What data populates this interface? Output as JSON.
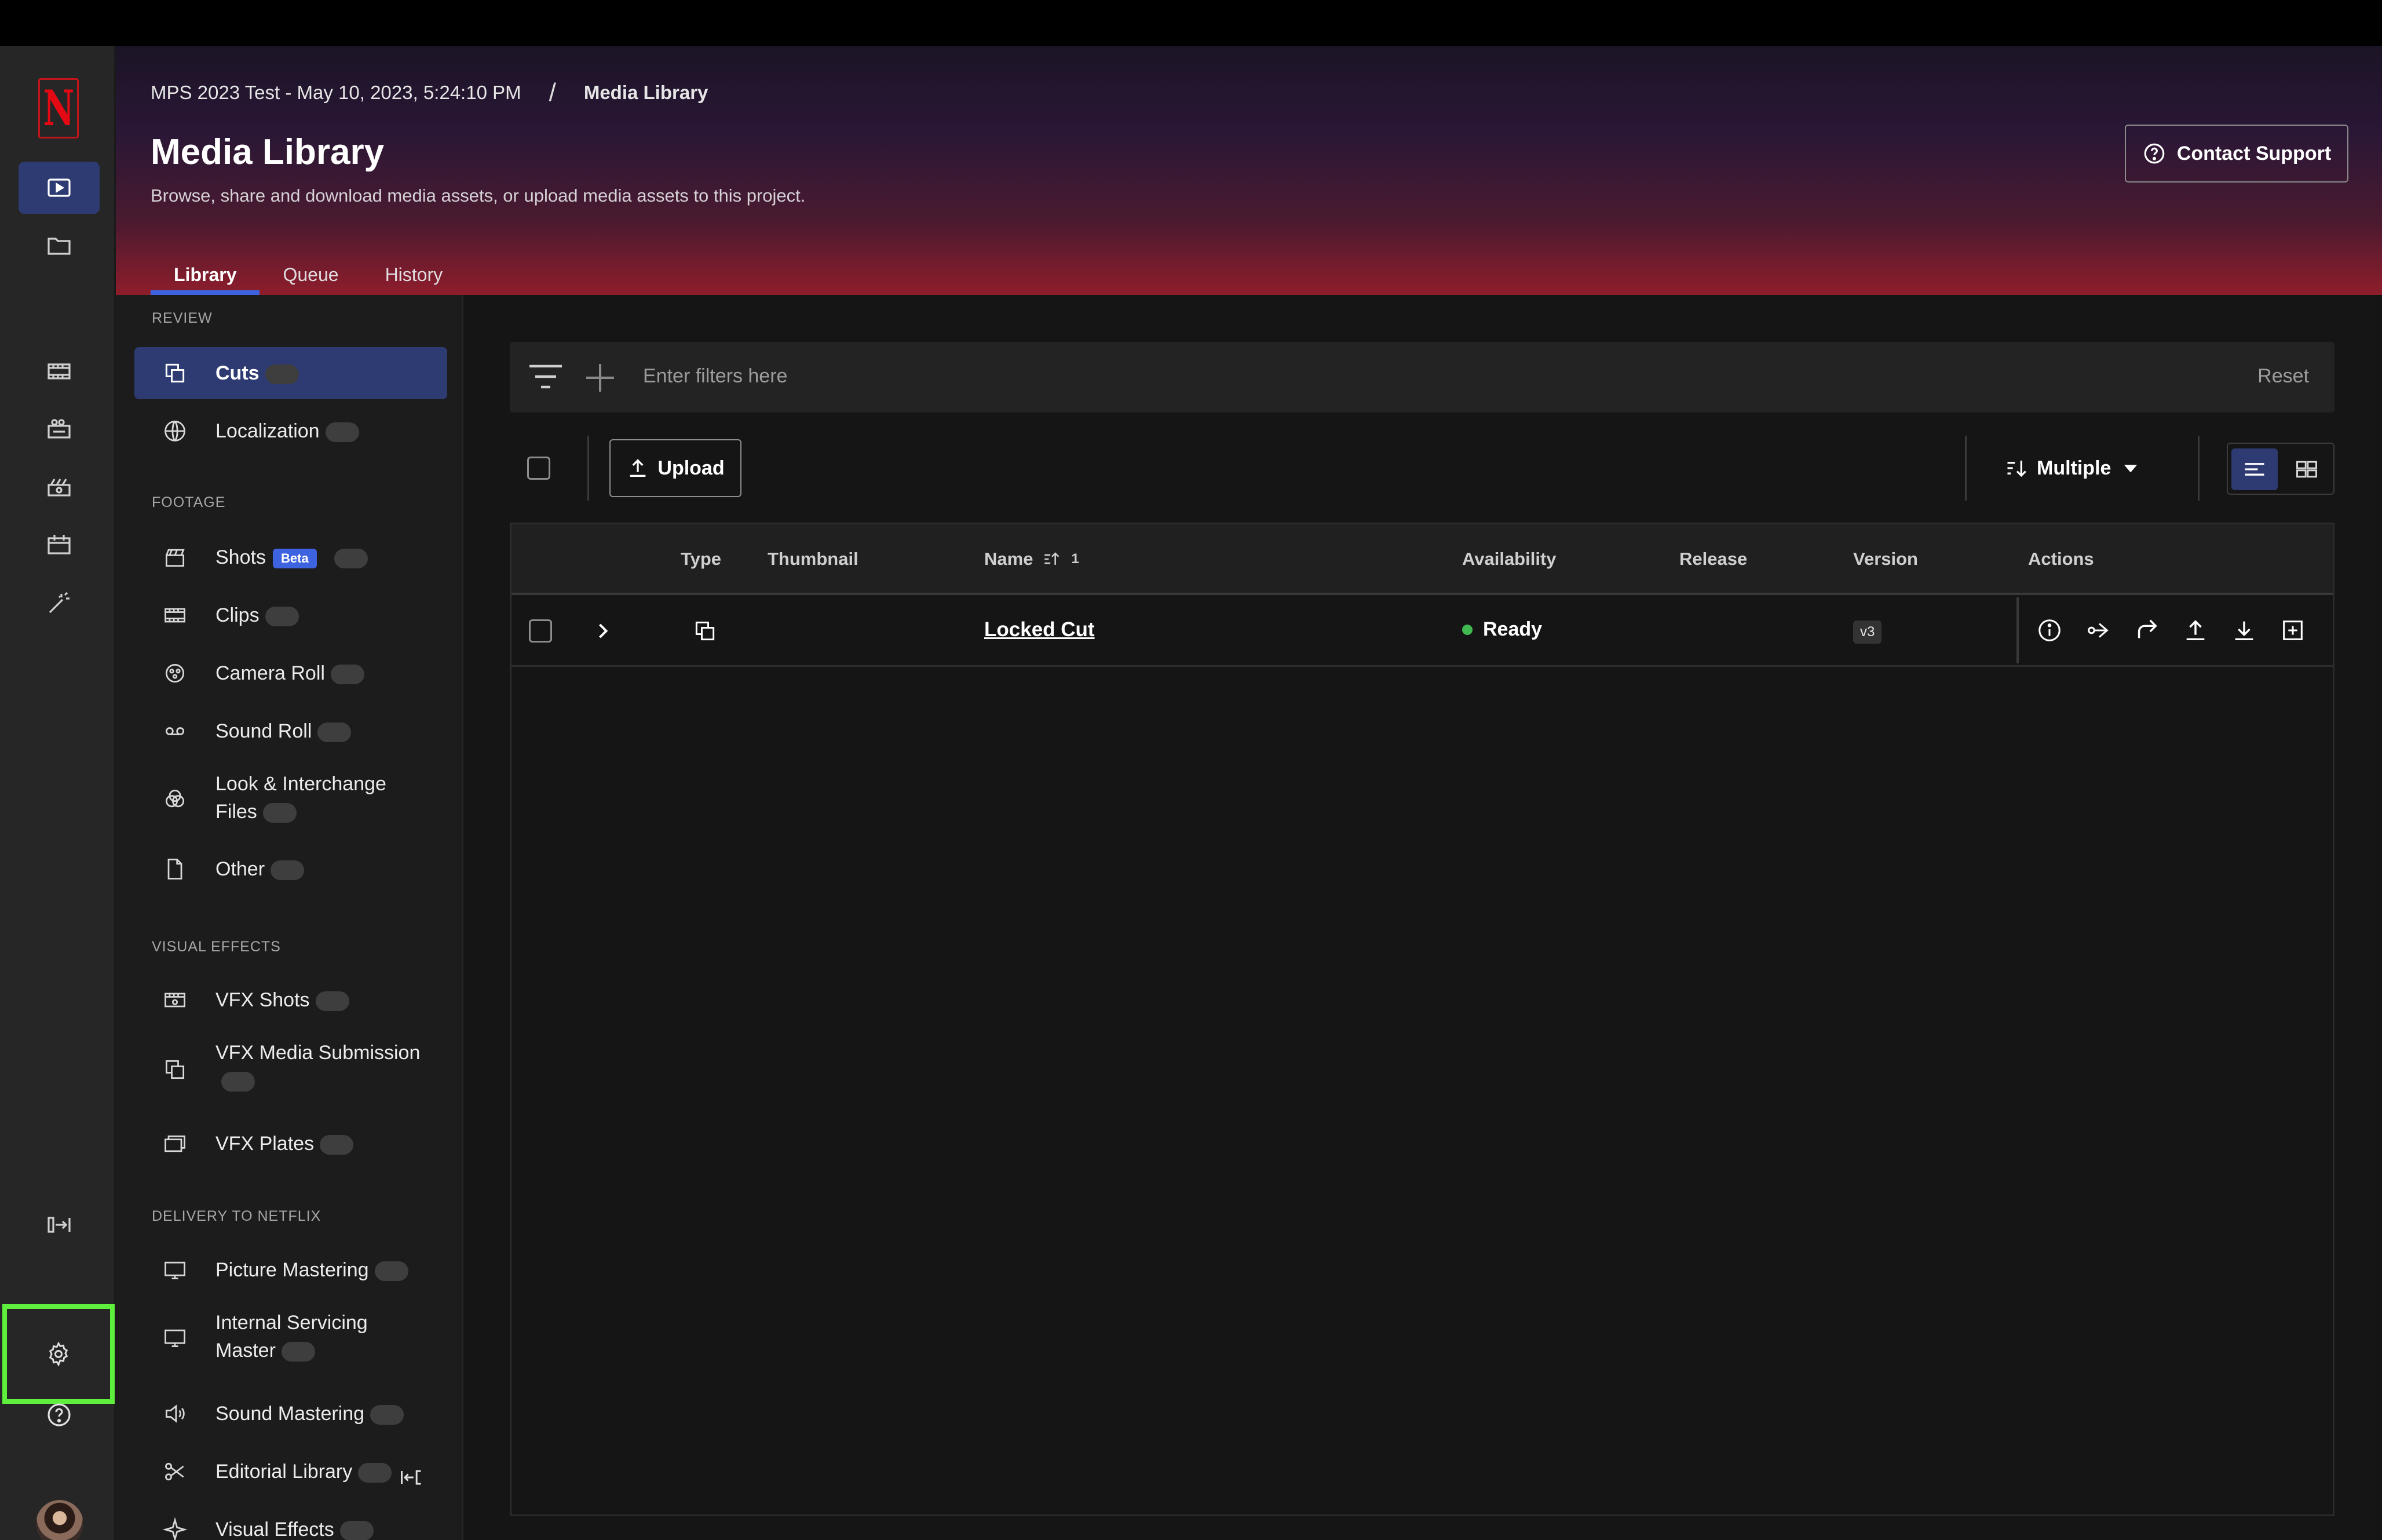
{
  "breadcrumb": {
    "project": "MPS 2023 Test - May 10, 2023, 5:24:10 PM",
    "separator": "/",
    "current": "Media Library"
  },
  "header": {
    "title": "Media Library",
    "subtitle": "Browse, share and download media assets, or upload media assets to this project.",
    "contact_support": "Contact Support"
  },
  "tabs": [
    {
      "label": "Library",
      "active": true
    },
    {
      "label": "Queue",
      "active": false
    },
    {
      "label": "History",
      "active": false
    }
  ],
  "rail": {
    "logo_letter": "N",
    "icons": [
      "media-library-icon",
      "folder-icon",
      "film-strip-icon",
      "camera-reel-icon",
      "camera-icon",
      "calendar-icon",
      "magic-wand-icon",
      "expand-panel-icon",
      "gear-icon",
      "help-icon",
      "avatar"
    ]
  },
  "sidebar": {
    "sections": [
      {
        "heading": "REVIEW",
        "items": [
          {
            "label": "Cuts",
            "icon": "cuts-icon",
            "active": true
          },
          {
            "label": "Localization",
            "icon": "globe-icon"
          }
        ]
      },
      {
        "heading": "FOOTAGE",
        "items": [
          {
            "label": "Shots",
            "icon": "clapperboard-icon",
            "badge": "Beta"
          },
          {
            "label": "Clips",
            "icon": "film-icon"
          },
          {
            "label": "Camera Roll",
            "icon": "camera-roll-icon"
          },
          {
            "label": "Sound Roll",
            "icon": "tape-icon"
          },
          {
            "label": "Look & Interchange Files",
            "icon": "color-circles-icon"
          },
          {
            "label": "Other",
            "icon": "document-icon"
          }
        ]
      },
      {
        "heading": "VISUAL EFFECTS",
        "items": [
          {
            "label": "VFX Shots",
            "icon": "vfx-film-icon"
          },
          {
            "label": "VFX Media Submission",
            "icon": "stack-icon"
          },
          {
            "label": "VFX Plates",
            "icon": "plates-icon"
          }
        ]
      },
      {
        "heading": "DELIVERY TO NETFLIX",
        "items": [
          {
            "label": "Picture Mastering",
            "icon": "monitor-icon"
          },
          {
            "label": "Internal Servicing Master",
            "icon": "monitor-icon"
          },
          {
            "label": "Sound Mastering",
            "icon": "speaker-icon"
          },
          {
            "label": "Editorial Library",
            "icon": "scissors-icon"
          },
          {
            "label": "Visual Effects",
            "icon": "sparkle-icon"
          }
        ]
      }
    ]
  },
  "filter": {
    "placeholder": "Enter filters here",
    "reset": "Reset"
  },
  "toolbar": {
    "upload": "Upload",
    "sort": "Multiple"
  },
  "table": {
    "columns": [
      "Type",
      "Thumbnail",
      "Name",
      "Availability",
      "Release",
      "Version",
      "Actions"
    ],
    "name_sort_indicator": "1",
    "rows": [
      {
        "type_icon": "cuts-icon",
        "name": "Locked Cut",
        "availability": "Ready",
        "release": "",
        "version": "v3"
      }
    ],
    "action_icons": [
      "info-icon",
      "share-icon",
      "forward-icon",
      "upload-icon",
      "download-icon",
      "add-icon"
    ]
  },
  "colors": {
    "accent": "#3d63e0",
    "active_bg": "#2e3b72",
    "ready": "#3fb950",
    "highlight": "#5ef03c",
    "brand": "#e50914"
  }
}
